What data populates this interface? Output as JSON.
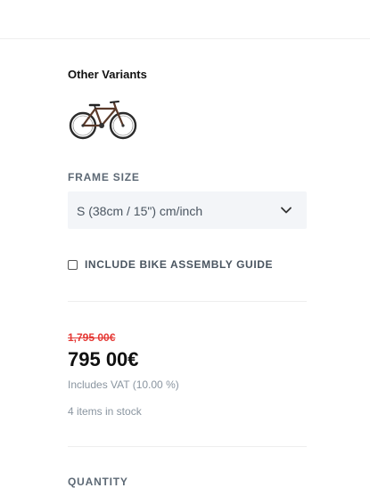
{
  "variants": {
    "title": "Other Variants",
    "thumbnail_icon": "bicycle-icon"
  },
  "frame_size": {
    "label": "FRAME SIZE",
    "selected": "S (38cm / 15\") cm/inch",
    "chevron_icon": "chevron-down-icon"
  },
  "assembly": {
    "label": "INCLUDE BIKE ASSEMBLY GUIDE",
    "checked": false
  },
  "pricing": {
    "old_price": "1,795 00€",
    "price": "795 00€",
    "vat": "Includes VAT (10.00 %)",
    "stock": "4 items in stock"
  },
  "quantity": {
    "label": "QUANTITY"
  },
  "colors": {
    "sale_red": "#e53935",
    "muted_text": "#8a95a0",
    "label_text": "#5d6975",
    "select_bg": "#f3f5f8"
  }
}
